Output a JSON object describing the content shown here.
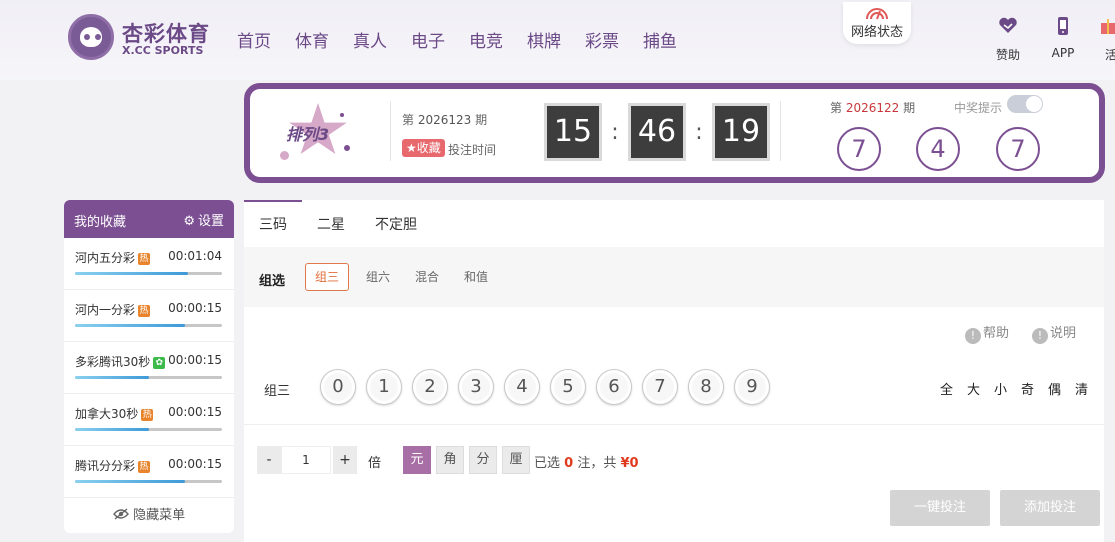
{
  "header": {
    "logo_title": "杏彩体育",
    "logo_sub": "X.CC SPORTS",
    "nav": [
      "首页",
      "体育",
      "真人",
      "电子",
      "电竞",
      "棋牌",
      "彩票",
      "捕鱼"
    ],
    "network_status": "网络状态",
    "tools": [
      {
        "label": "赞助",
        "icon": "heart-handshake-icon"
      },
      {
        "label": "APP",
        "icon": "phone-icon"
      },
      {
        "label": "活",
        "icon": "gift-icon"
      }
    ]
  },
  "banner": {
    "game_name": "排列3",
    "period_prefix": "第",
    "period_number": "2026123",
    "period_suffix": "期",
    "favorite_label": "收藏",
    "bet_time_label": "投注时间",
    "countdown": {
      "hours": "15",
      "minutes": "46",
      "seconds": "19"
    },
    "last_period_prefix": "第",
    "last_period_number": "2026122",
    "last_period_suffix": "期",
    "win_tip_label": "中奖提示",
    "win_tip_enabled": false,
    "results": [
      "7",
      "4",
      "7"
    ]
  },
  "sidebar": {
    "title": "我的收藏",
    "settings_label": "设置",
    "items": [
      {
        "name": "河内五分彩",
        "badge": "热",
        "badge_color": "#e8842c",
        "time": "00:01:04",
        "progress": 0.77
      },
      {
        "name": "河内一分彩",
        "badge": "热",
        "badge_color": "#e8842c",
        "time": "00:00:15",
        "progress": 0.75
      },
      {
        "name": "多彩腾讯30秒",
        "badge": "✿",
        "badge_color": "#3cba4a",
        "time": "00:00:15",
        "progress": 0.5
      },
      {
        "name": "加拿大30秒",
        "badge": "热",
        "badge_color": "#e8842c",
        "time": "00:00:15",
        "progress": 0.5
      },
      {
        "name": "腾讯分分彩",
        "badge": "热",
        "badge_color": "#e8842c",
        "time": "00:00:15",
        "progress": 0.75
      }
    ],
    "hide_menu_label": "隐藏菜单"
  },
  "panel": {
    "tabs": [
      "三码",
      "二星",
      "不定胆"
    ],
    "subtabs_label": "组选",
    "subtabs": [
      "组三",
      "组六",
      "混合",
      "和值"
    ],
    "help_label": "帮助",
    "explain_label": "说明",
    "row_label": "组三",
    "numbers": [
      "0",
      "1",
      "2",
      "3",
      "4",
      "5",
      "6",
      "7",
      "8",
      "9"
    ],
    "quick_picks": [
      "全",
      "大",
      "小",
      "奇",
      "偶",
      "清"
    ],
    "multiplier_value": "1",
    "minus_label": "-",
    "plus_label": "+",
    "multiplier_unit": "倍",
    "units": [
      "元",
      "角",
      "分",
      "厘"
    ],
    "selected_prefix": "已选",
    "selected_count": "0",
    "selected_mid": "注，共",
    "total_amount": "¥0",
    "one_click_bet": "一键投注",
    "add_bet": "添加投注"
  },
  "colors": {
    "brand": "#7b4f92",
    "accent": "#e26e3a",
    "highlight": "#e03a1e"
  }
}
